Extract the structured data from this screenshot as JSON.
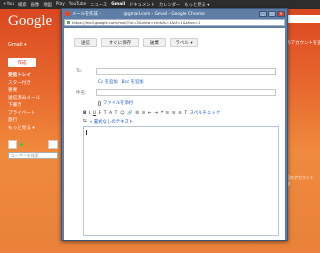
{
  "topbar": {
    "items": [
      "+You",
      "検索",
      "画像",
      "地図",
      "Play",
      "YouTube",
      "ニュース",
      "Gmail",
      "ドキュメント",
      "カレンダー",
      "もっと見る ▾"
    ],
    "active_index": 7
  },
  "background": {
    "logo": "Google",
    "gmail_label": "Gmail ▾",
    "compose_label": "作成",
    "nav": [
      "受信トレイ",
      "スター付き",
      "重要",
      "送信済みメール",
      "下書き",
      "プライベート",
      "旅行",
      "もっと見る ▾"
    ],
    "chat_search_placeholder": "ユーザーを検索",
    "right_link": "他のアカウントを追加",
    "footer_lines": [
      "前回のアカウント",
      "詳細"
    ]
  },
  "popup": {
    "title": "メールを作成 - 　　　　　@gmail.com - Gmail - Google Chrome",
    "url": "https://mail.google.com/mail/?ui=2&view=cm&fs=1&tf=1&shva=1",
    "window_buttons": [
      "_",
      "□",
      "×"
    ]
  },
  "compose": {
    "send_label": "送信",
    "save_label": "すぐに保存",
    "discard_label": "破棄",
    "labels_label": "ラベル ▾",
    "to_label": "To:",
    "add_cc_label": "Cc を追加",
    "add_bcc_label": "Bcc を追加",
    "subject_label": "件名:",
    "attach_label": "ファイルを添付",
    "format_buttons": [
      "B",
      "I",
      "U",
      "F",
      "T",
      "A",
      "T",
      "☺",
      "🔗",
      "☰",
      "≡",
      "⇤",
      "⇥",
      "❝",
      "≡",
      "≡",
      "≡",
      "T"
    ],
    "spellcheck_label": "スペルチェック",
    "plain_text_label": "« 書式なしのテキスト",
    "body_text": ""
  },
  "colors": {
    "accent": "#5f7ea6",
    "gmail_bg": "#e8692e",
    "link": "#1a55c5"
  }
}
